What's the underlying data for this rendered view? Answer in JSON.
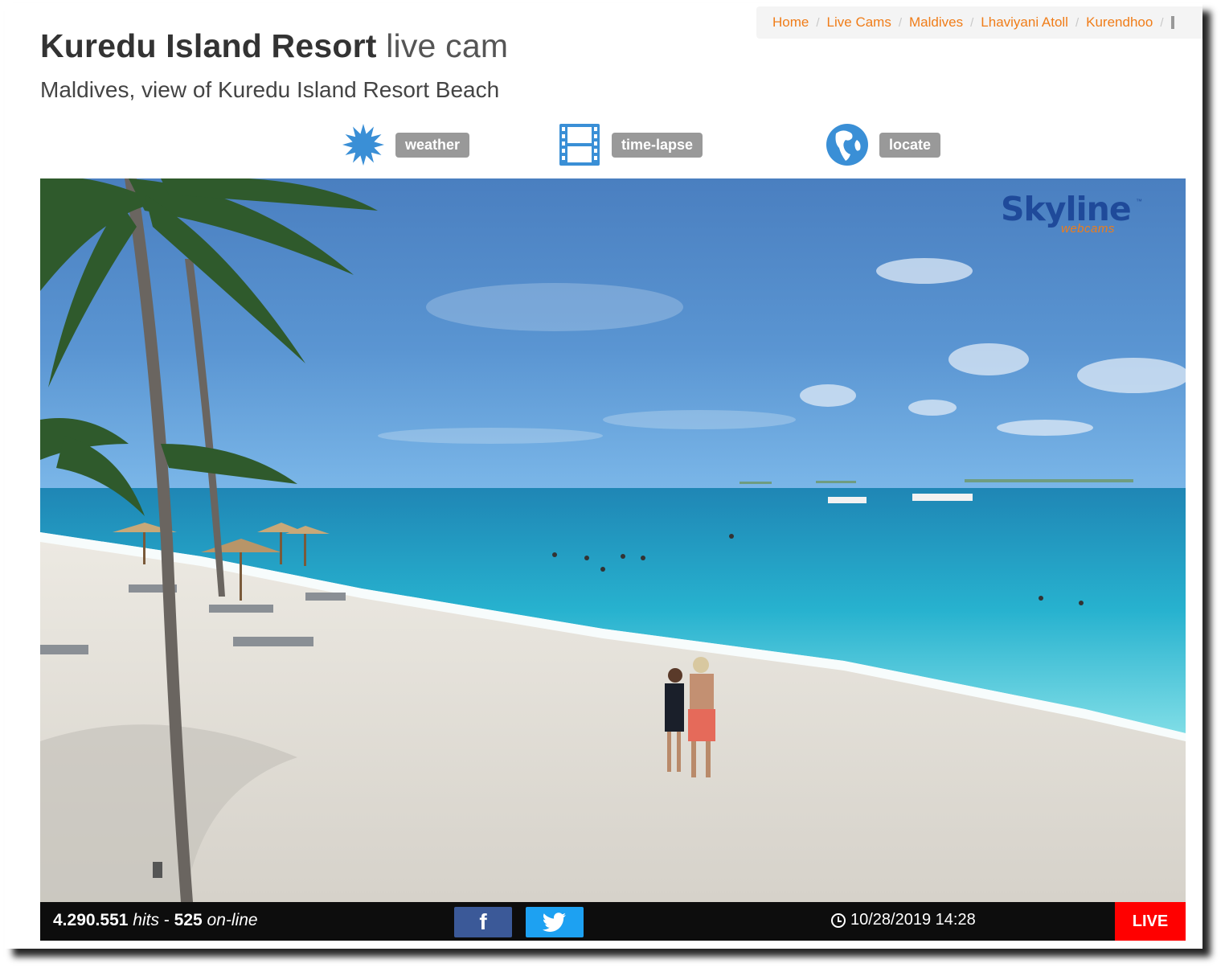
{
  "breadcrumb": {
    "items": [
      "Home",
      "Live Cams",
      "Maldives",
      "Lhaviyani Atoll",
      "Kurendhoo"
    ],
    "separator": "/"
  },
  "header": {
    "title_strong": "Kuredu Island Resort",
    "title_light": "live cam",
    "subtitle": "Maldives, view of Kuredu Island Resort Beach"
  },
  "actions": [
    {
      "label": "weather",
      "icon": "weather-sun-icon"
    },
    {
      "label": "time-lapse",
      "icon": "film-strip-icon"
    },
    {
      "label": "locate",
      "icon": "globe-icon"
    }
  ],
  "player": {
    "logo_main": "Skyline",
    "logo_sub": "webcams",
    "logo_tm": "™",
    "hits_count": "4.290.551",
    "hits_label": "hits",
    "dash": "-",
    "online_count": "525",
    "online_label": "on-line",
    "facebook_glyph": "f",
    "datetime": "10/28/2019 14:28",
    "live_label": "LIVE"
  },
  "colors": {
    "link_orange": "#f07d19",
    "icon_blue": "#3a8fd6",
    "live_red": "#ff0000",
    "facebook_blue": "#3b5998",
    "twitter_blue": "#1da1f2"
  }
}
